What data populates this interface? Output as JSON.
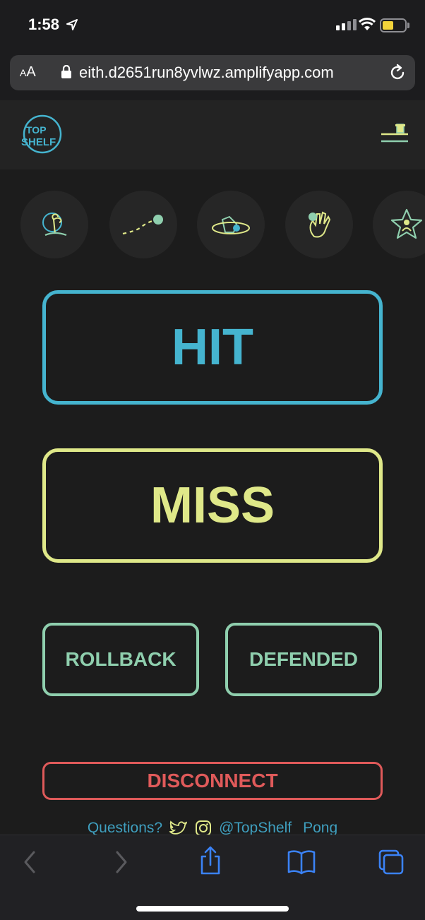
{
  "status_bar": {
    "time": "1:58",
    "battery_color": "#f2d33a"
  },
  "browser": {
    "text_size_label": "AA",
    "url": "eith.d2651run8yvlwz.amplifyapp.com"
  },
  "app": {
    "logo_text_top": "TOP",
    "logo_text_bottom": "SHELF",
    "mode_icons": [
      "island-icon",
      "ball-bounce-icon",
      "ball-orbit-icon",
      "hand-ball-icon",
      "star-person-icon"
    ]
  },
  "actions": {
    "hit_label": "HIT",
    "miss_label": "MISS",
    "rollback_label": "ROLLBACK",
    "defended_label": "DEFENDED",
    "disconnect_label": "DISCONNECT"
  },
  "footer": {
    "questions_label": "Questions?",
    "handle": "@TopShelf",
    "pong_label": "Pong"
  },
  "colors": {
    "hit": "#45b4cf",
    "miss": "#dfe889",
    "secondary": "#8fcfae",
    "danger": "#df5a5a",
    "background": "#1c1c1c",
    "safari_blue": "#3b82f6"
  }
}
